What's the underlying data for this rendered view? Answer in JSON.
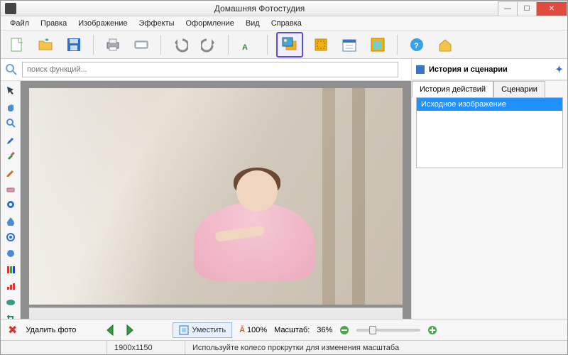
{
  "window": {
    "title": "Домашняя Фотостудия"
  },
  "menu": [
    "Файл",
    "Правка",
    "Изображение",
    "Эффекты",
    "Оформление",
    "Вид",
    "Справка"
  ],
  "toolbar_icons": [
    "new-doc",
    "open-folder",
    "save",
    "print",
    "scan",
    "undo",
    "redo",
    "text",
    "layers-highlight",
    "crop",
    "calendar",
    "frame",
    "help",
    "home"
  ],
  "search": {
    "placeholder": "поиск функций..."
  },
  "left_tools": [
    "pointer",
    "hand",
    "zoom",
    "eyedropper",
    "brush",
    "pencil",
    "eraser",
    "clone",
    "blur",
    "sharpen",
    "dodge",
    "channels",
    "levels",
    "heal",
    "crop-tool"
  ],
  "right_panel": {
    "title": "История и сценарии",
    "tabs": [
      "История действий",
      "Сценарии"
    ],
    "active_tab": 0,
    "history": [
      "Исходное изображение"
    ]
  },
  "bottom": {
    "delete_label": "Удалить фото",
    "fit_label": "Уместить",
    "hundred": "100%",
    "scale_label": "Масштаб:",
    "scale_value": "36%"
  },
  "status": {
    "dimensions": "1900x1150",
    "hint": "Используйте колесо прокрутки для изменения масштаба"
  },
  "colors": {
    "accent": "#1e90ff",
    "hl_border": "#5a4fcf"
  }
}
